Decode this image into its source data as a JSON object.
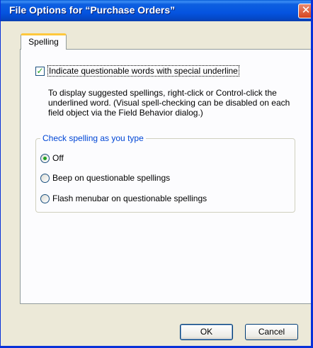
{
  "window": {
    "title": "File Options for “Purchase Orders”",
    "close_label": "✕"
  },
  "tabs": [
    {
      "label": "Spelling",
      "selected": true
    }
  ],
  "spelling": {
    "indicate_label": "Indicate questionable words with special underline",
    "indicate_checked": true,
    "description": "To display suggested spellings, right-click or Control-click the underlined word. (Visual spell-checking can be disabled on each field object via the Field Behavior dialog.)",
    "group_title": "Check spelling as you type",
    "options": [
      {
        "label": "Off",
        "checked": true
      },
      {
        "label": "Beep on questionable spellings",
        "checked": false
      },
      {
        "label": "Flash menubar on questionable spellings",
        "checked": false
      }
    ]
  },
  "buttons": {
    "ok": "OK",
    "cancel": "Cancel"
  }
}
